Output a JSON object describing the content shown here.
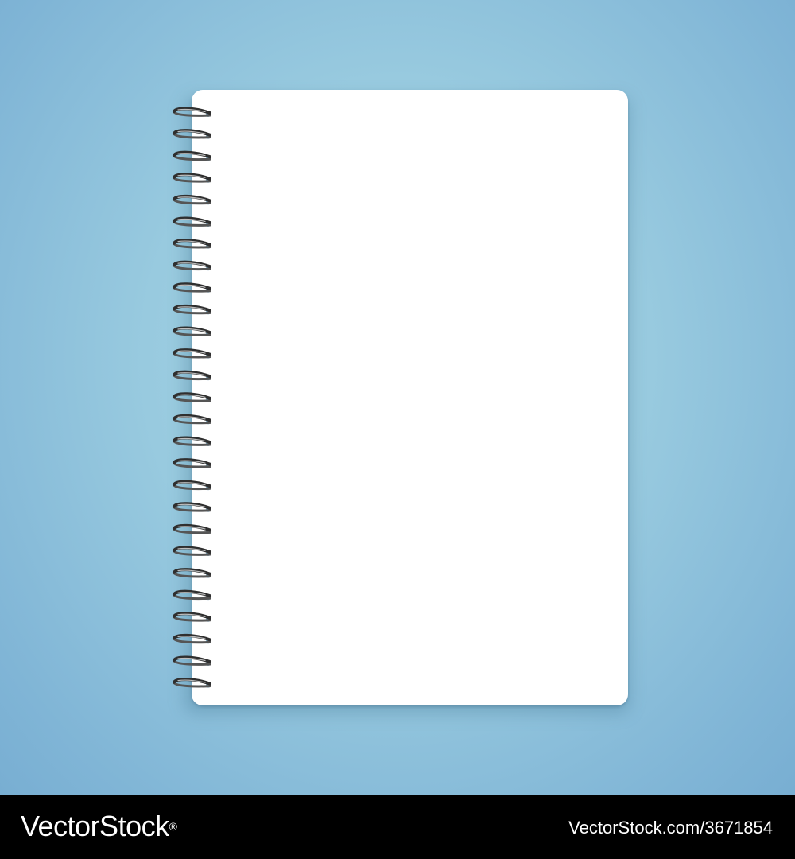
{
  "scene": {
    "background_color": "#98cadf",
    "page_color": "#ffffff",
    "ring_color": "#2f2f2f"
  },
  "footer": {
    "logo": "VectorStock",
    "logo_mark": "®",
    "image_id": "VectorStock.com/3671854"
  }
}
